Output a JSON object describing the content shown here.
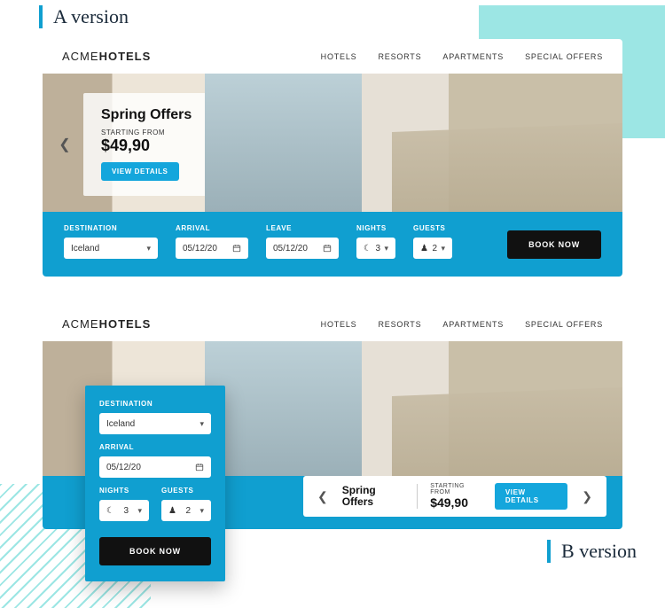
{
  "labels": {
    "versionA": "A version",
    "versionB": "B version"
  },
  "brand": {
    "acme": "ACME",
    "hotels": "HOTELS"
  },
  "nav": [
    "HOTELS",
    "RESORTS",
    "APARTMENTS",
    "SPECIAL OFFERS"
  ],
  "offer": {
    "title": "Spring Offers",
    "startingFrom": "STARTING FROM",
    "price": "$49,90",
    "viewDetails": "VIEW DETAILS"
  },
  "search": {
    "destinationLabel": "DESTINATION",
    "destinationValue": "Iceland",
    "arrivalLabel": "ARRIVAL",
    "arrivalValue": "05/12/20",
    "leaveLabel": "LEAVE",
    "leaveValue": "05/12/20",
    "nightsLabel": "NIGHTS",
    "nightsValue": "3",
    "guestsLabel": "GUESTS",
    "guestsValue": "2",
    "bookNow": "BOOK NOW"
  }
}
